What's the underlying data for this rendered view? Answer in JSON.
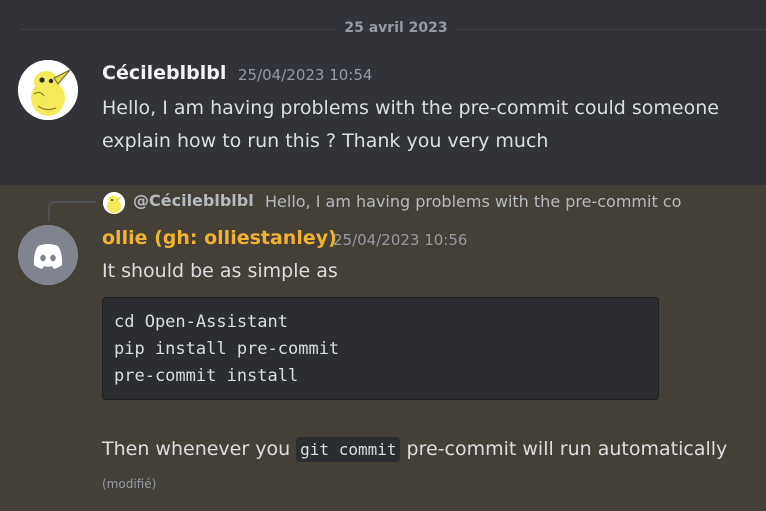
{
  "date_divider": "25 avril 2023",
  "message1": {
    "username": "Cécileblblbl",
    "timestamp": "25/04/2023 10:54",
    "text": "Hello, I am having problems with the pre-commit could someone explain how to run this ? Thank you very much"
  },
  "message2": {
    "reply": {
      "mention": "@Cécileblblbl",
      "preview": "Hello, I am having problems with the pre-commit co"
    },
    "username": "ollie (gh: olliestanley)",
    "username_color": "#f0b232",
    "timestamp": "25/04/2023 10:56",
    "intro": "It should be as simple as",
    "code_lines": [
      "cd Open-Assistant",
      "pip install pre-commit",
      "pre-commit install"
    ],
    "outro_before": "Then whenever you ",
    "inline_code": "git commit",
    "outro_after": " pre-commit will run automatically",
    "edited_label": "(modifié)"
  },
  "icons": {
    "avatar1": "yellow-bird-avatar-icon",
    "avatar2": "discord-logo-icon"
  }
}
